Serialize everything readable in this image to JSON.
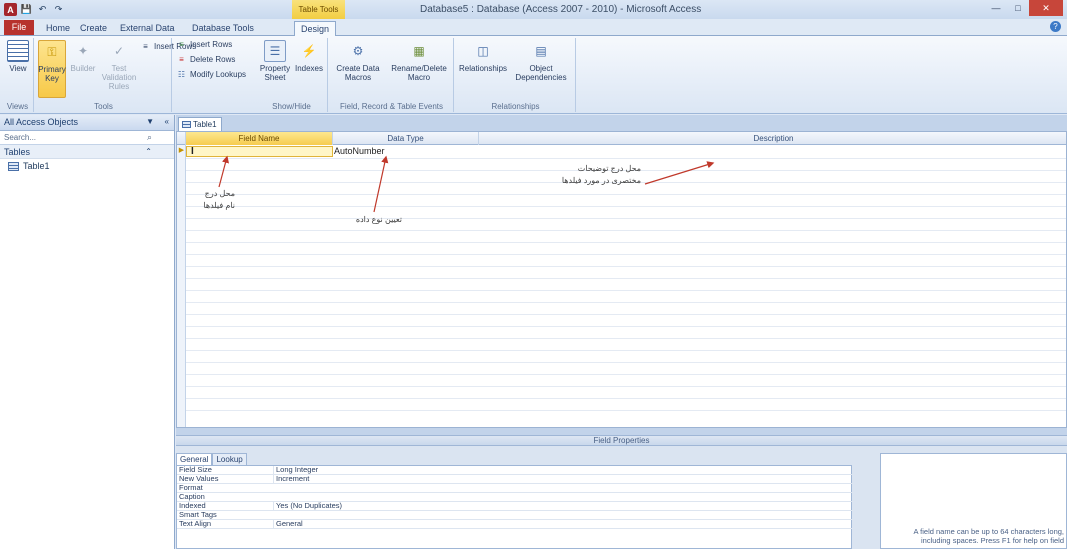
{
  "window": {
    "title": "Database5 : Database (Access 2007 - 2010) - Microsoft Access",
    "context_tab_header": "Table Tools",
    "quick_access": [
      "save-icon",
      "undo-icon",
      "redo-icon"
    ],
    "controls": [
      "minimize",
      "maximize",
      "close"
    ]
  },
  "tabs": [
    "File",
    "Home",
    "Create",
    "External Data",
    "Database Tools",
    "Design"
  ],
  "active_tab": "Design",
  "ribbon": {
    "views": {
      "label": "Views",
      "view_btn": "View"
    },
    "tools": {
      "label": "Tools",
      "primary_key": "Primary Key",
      "builder": "Builder",
      "test_validation": "Test Validation Rules",
      "insert_rows": "Insert Rows",
      "delete_rows": "Delete Rows",
      "modify_lookups": "Modify Lookups"
    },
    "show_hide": {
      "label": "Show/Hide",
      "property_sheet": "Property Sheet",
      "indexes": "Indexes"
    },
    "field_record_events": {
      "label": "Field, Record & Table Events",
      "create_data_macros": "Create Data Macros",
      "rename_delete_macro": "Rename/Delete Macro"
    },
    "relationships": {
      "label": "Relationships",
      "relationships_btn": "Relationships",
      "object_dependencies": "Object Dependencies"
    }
  },
  "nav": {
    "header": "All Access Objects",
    "search_placeholder": "Search...",
    "group": "Tables",
    "items": [
      "Table1"
    ]
  },
  "document": {
    "tab": "Table1",
    "columns": [
      "Field Name",
      "Data Type",
      "Description"
    ],
    "rows": [
      {
        "field_name": "",
        "data_type": "AutoNumber",
        "description": ""
      }
    ],
    "annotations": {
      "field_name_note": [
        "محل درج",
        "نام فیلدها"
      ],
      "data_type_note": "تعیین نوع داده",
      "description_note": [
        "محل درج توضیحات",
        "مختصری در مورد فیلدها"
      ]
    }
  },
  "field_properties": {
    "bar_label": "Field Properties",
    "tabs": [
      "General",
      "Lookup"
    ],
    "rows": [
      {
        "k": "Field Size",
        "v": "Long Integer"
      },
      {
        "k": "New Values",
        "v": "Increment"
      },
      {
        "k": "Format",
        "v": ""
      },
      {
        "k": "Caption",
        "v": ""
      },
      {
        "k": "Indexed",
        "v": "Yes (No Duplicates)"
      },
      {
        "k": "Smart Tags",
        "v": ""
      },
      {
        "k": "Text Align",
        "v": "General"
      }
    ],
    "help": "A field name can be up to 64 characters long, including spaces. Press F1 for help on field"
  },
  "colors": {
    "accent_file": "#b7322d",
    "selection": "#f7c948",
    "ribbon_bg": "#dbe6f4",
    "grid_border": "#9fb6d6"
  }
}
